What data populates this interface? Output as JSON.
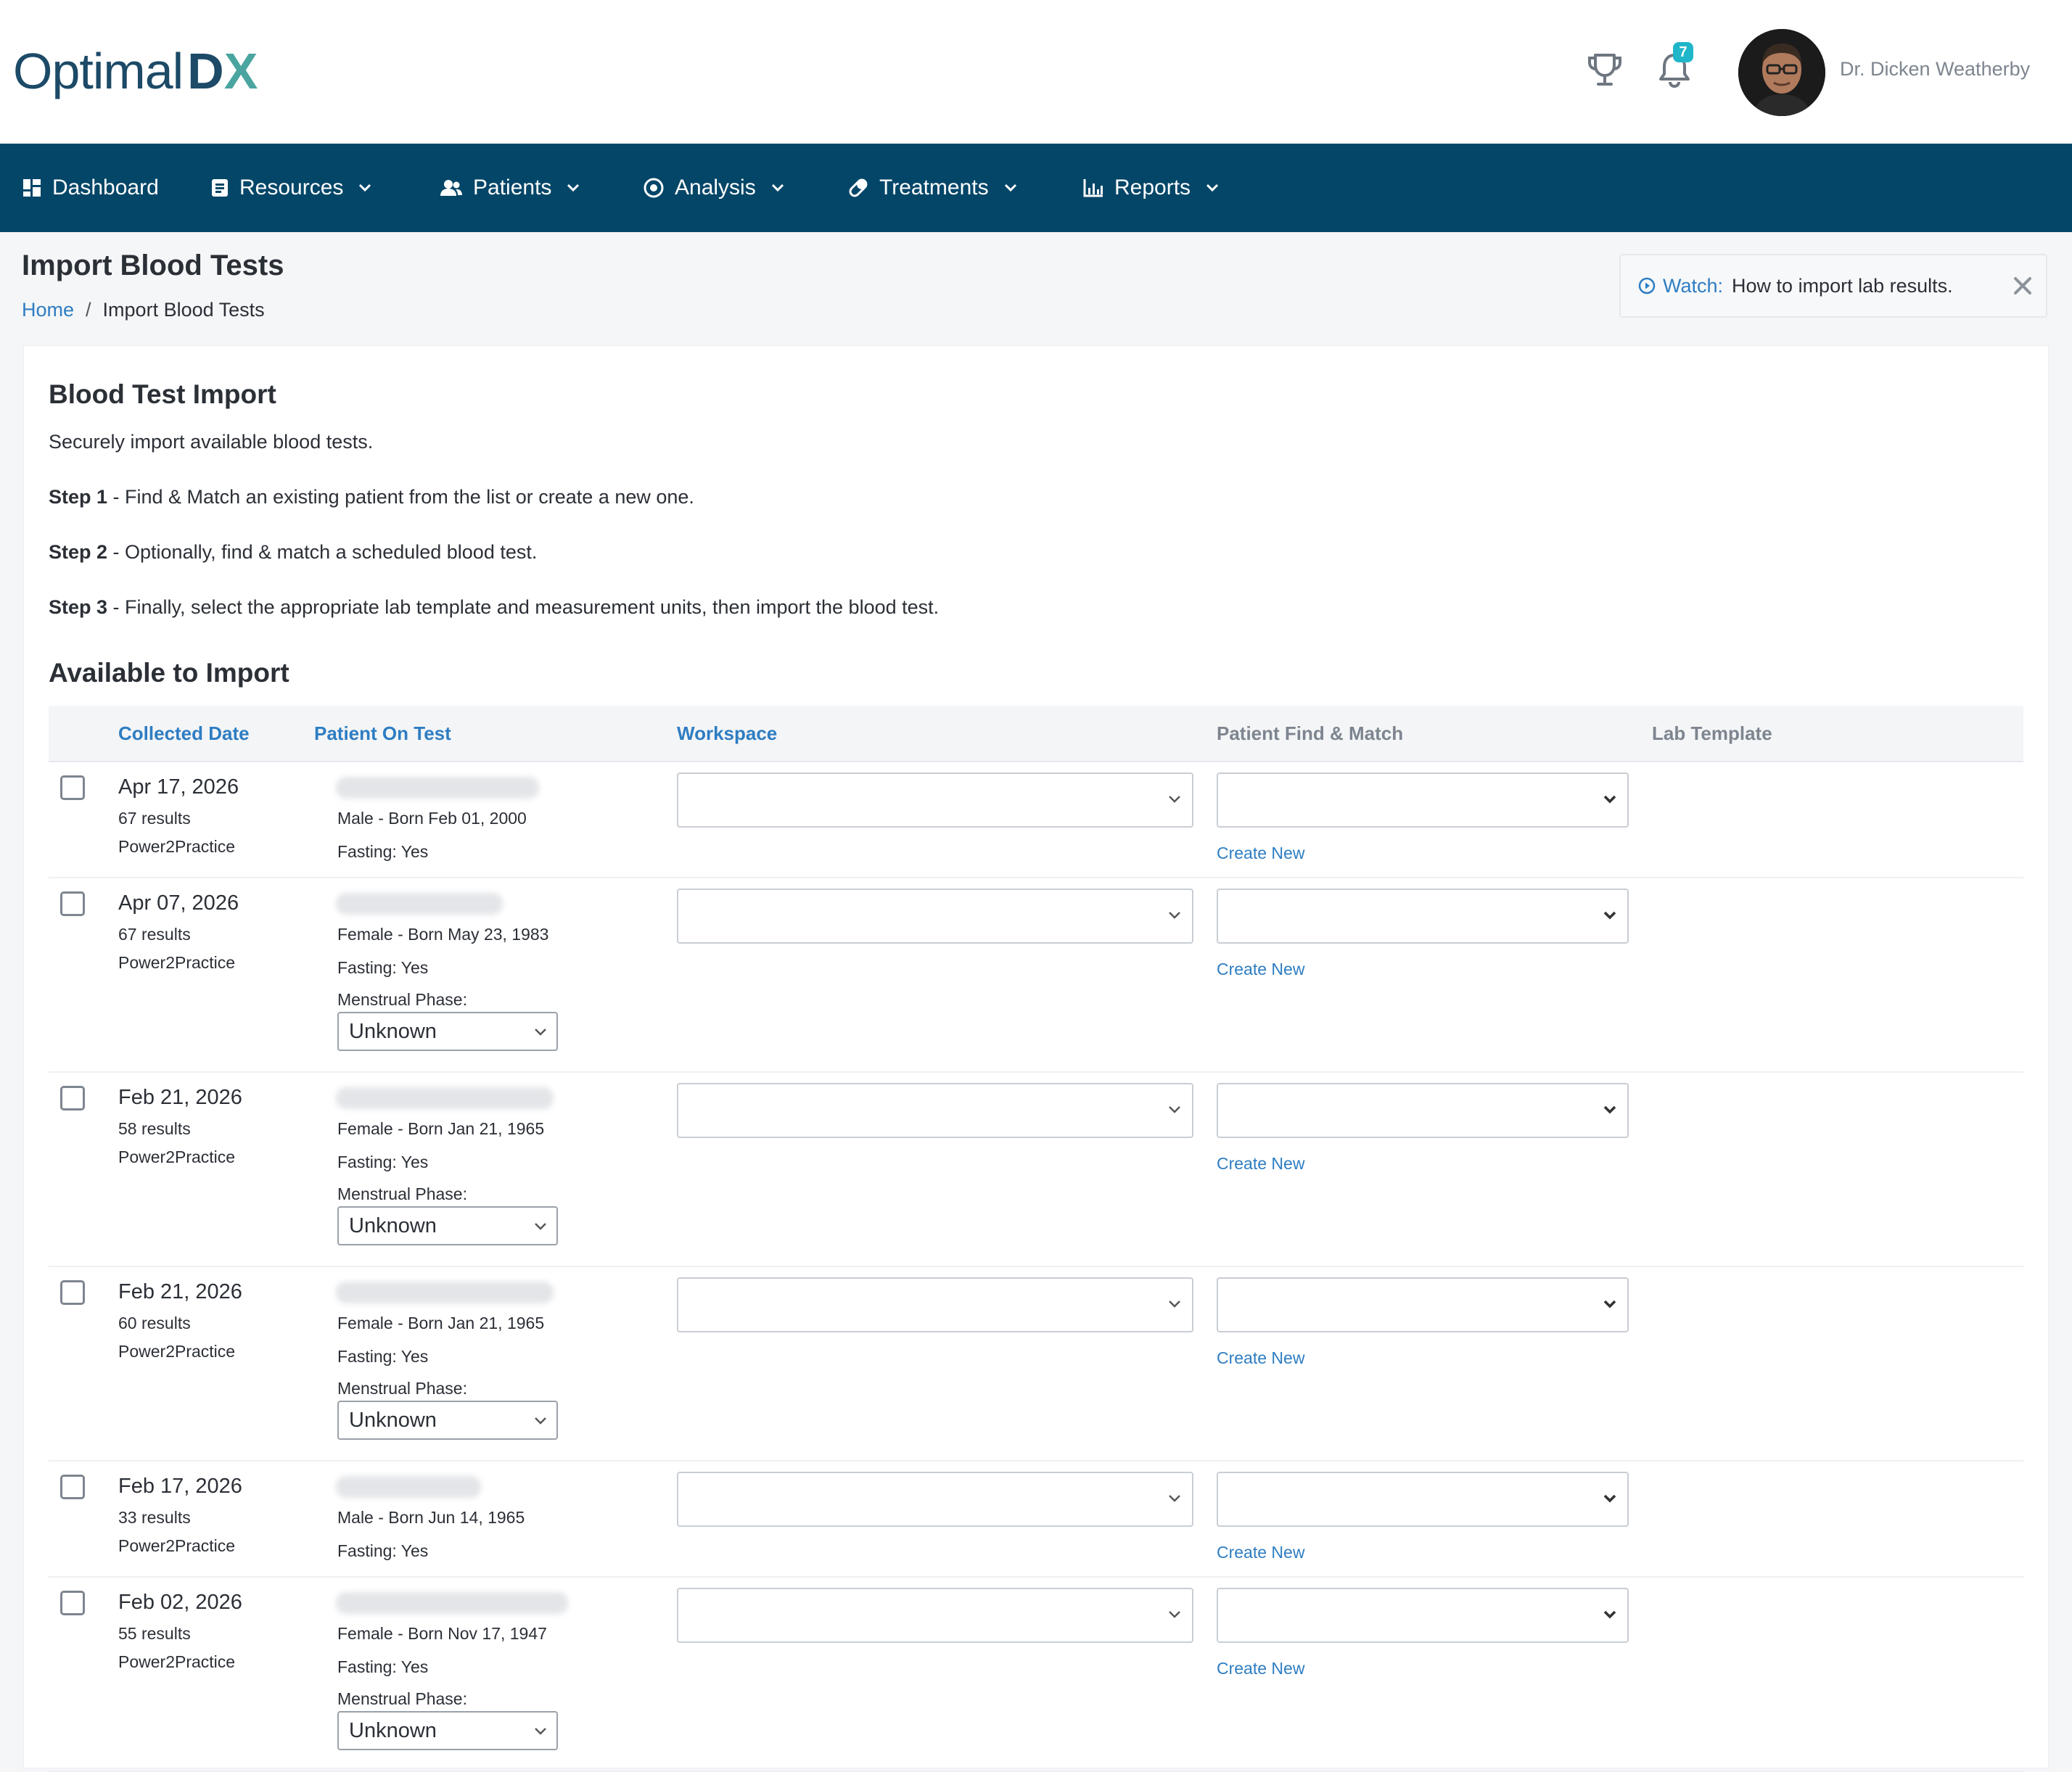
{
  "brand": {
    "logo_text": "Optimal",
    "logo_dx_d": "D",
    "logo_dx_x": "X"
  },
  "header": {
    "notification_count": "7",
    "user_name": "Dr. Dicken Weatherby"
  },
  "nav": [
    {
      "label": "Dashboard",
      "icon": "dashboard-icon"
    },
    {
      "label": "Resources",
      "icon": "document-icon"
    },
    {
      "label": "Patients",
      "icon": "people-icon"
    },
    {
      "label": "Analysis",
      "icon": "target-icon"
    },
    {
      "label": "Treatments",
      "icon": "pill-icon"
    },
    {
      "label": "Reports",
      "icon": "bar-chart-icon"
    }
  ],
  "page": {
    "title": "Import Blood Tests",
    "breadcrumb": {
      "home": "Home",
      "separator": "/",
      "current": "Import Blood Tests"
    },
    "watch": {
      "label": "Watch:",
      "text": "How to import lab results."
    }
  },
  "card": {
    "title": "Blood Test Import",
    "intro": "Securely import available blood tests.",
    "steps": [
      {
        "label": "Step 1",
        "text": " - Find & Match an existing patient from the list or create a new one."
      },
      {
        "label": "Step 2",
        "text": " - Optionally, find & match a scheduled blood test."
      },
      {
        "label": "Step 3",
        "text": " - Finally, select the appropriate lab template and measurement units, then import the blood test."
      }
    ],
    "available_title": "Available to Import"
  },
  "table": {
    "headers": {
      "collected_date": "Collected Date",
      "patient_on_test": "Patient On Test",
      "workspace": "Workspace",
      "patient_find_match": "Patient Find & Match",
      "lab_template": "Lab Template"
    },
    "create_new_label": "Create New",
    "menstrual_label": "Menstrual Phase:",
    "rows": [
      {
        "date": "Apr 17, 2026",
        "results": "67 results",
        "source": "Power2Practice",
        "demographic": "Male - Born Feb 01, 2000",
        "fasting": "Fasting: Yes",
        "menstrual_phase": null
      },
      {
        "date": "Apr 07, 2026",
        "results": "67 results",
        "source": "Power2Practice",
        "demographic": "Female - Born May 23, 1983",
        "fasting": "Fasting: Yes",
        "menstrual_phase": "Unknown"
      },
      {
        "date": "Feb 21, 2026",
        "results": "58 results",
        "source": "Power2Practice",
        "demographic": "Female - Born Jan 21, 1965",
        "fasting": "Fasting: Yes",
        "menstrual_phase": "Unknown"
      },
      {
        "date": "Feb 21, 2026",
        "results": "60 results",
        "source": "Power2Practice",
        "demographic": "Female - Born Jan 21, 1965",
        "fasting": "Fasting: Yes",
        "menstrual_phase": "Unknown"
      },
      {
        "date": "Feb 17, 2026",
        "results": "33 results",
        "source": "Power2Practice",
        "demographic": "Male - Born Jun 14, 1965",
        "fasting": "Fasting: Yes",
        "menstrual_phase": null
      },
      {
        "date": "Feb 02, 2026",
        "results": "55 results",
        "source": "Power2Practice",
        "demographic": "Female - Born Nov 17, 1947",
        "fasting": "Fasting: Yes",
        "menstrual_phase": "Unknown"
      }
    ]
  },
  "colors": {
    "nav_bg": "#034668",
    "link": "#2e7dc2",
    "badge": "#1fb6c9",
    "brand": "#1c4a67",
    "brand_accent": "#4aa5a0"
  }
}
